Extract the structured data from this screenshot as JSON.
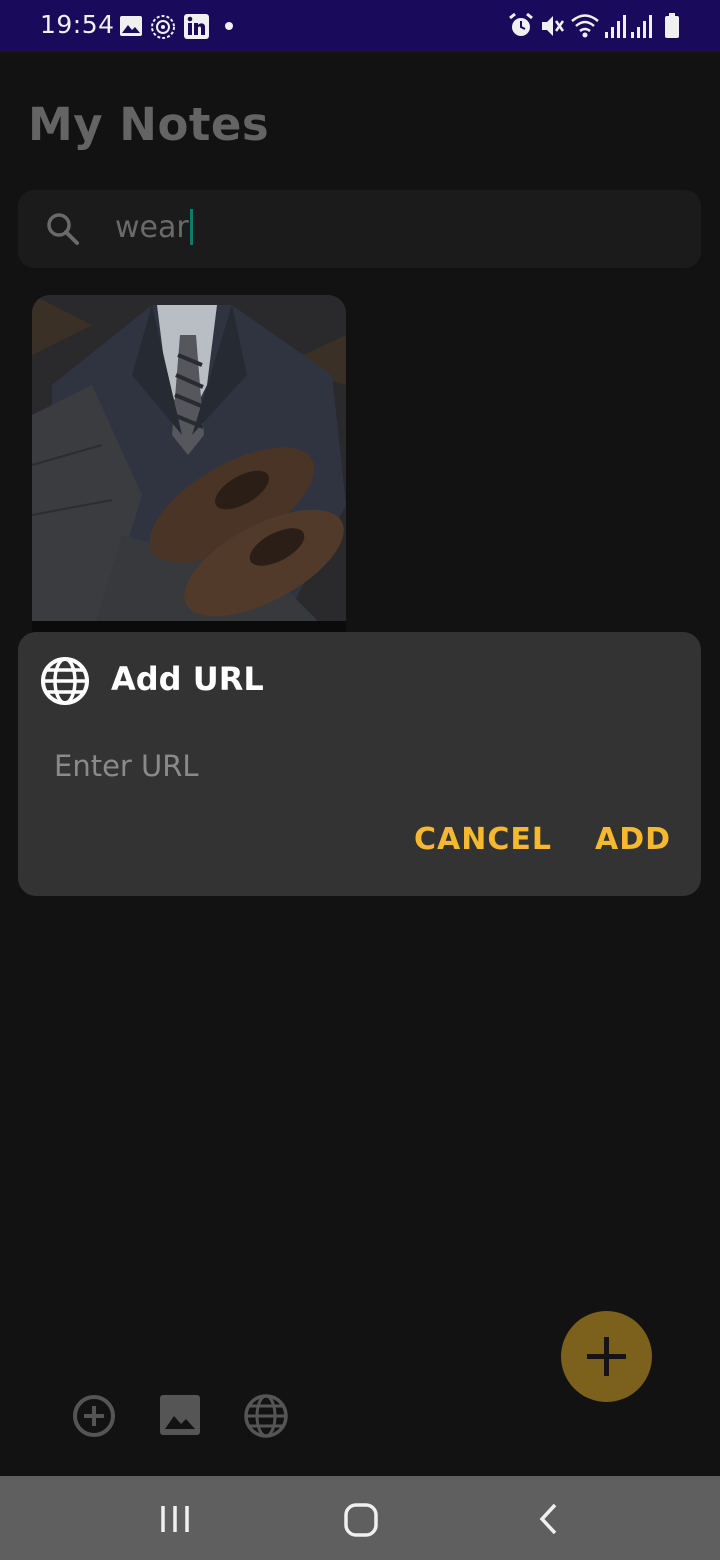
{
  "status_bar": {
    "time": "19:54",
    "left_icons": [
      "image-icon",
      "badge-icon",
      "linkedin-icon",
      "dot-icon"
    ],
    "right_icons": [
      "alarm-icon",
      "mute-icon",
      "wifi-icon",
      "signal-icon",
      "signal-icon",
      "battery-icon"
    ]
  },
  "app": {
    "title": "My Notes",
    "search": {
      "value": "wear",
      "icon": "search-icon"
    },
    "notes": [
      {
        "image": "suit-and-shoes-photo"
      }
    ],
    "bottom_actions": [
      "add-circle-icon",
      "image-icon",
      "globe-icon"
    ],
    "fab_icon": "plus-icon"
  },
  "dialog": {
    "title": "Add URL",
    "icon": "globe-icon",
    "input": {
      "placeholder": "Enter URL",
      "value": ""
    },
    "cancel_label": "CANCEL",
    "add_label": "ADD"
  },
  "colors": {
    "status_bar": "#1a0a5c",
    "background": "#121212",
    "dialog": "#333333",
    "accent": "#f5b82e",
    "fab": "#7c611c",
    "nav_bar": "#5f5f5f"
  },
  "nav_bar": {
    "buttons": [
      "recent-apps-icon",
      "home-icon",
      "back-icon"
    ]
  }
}
